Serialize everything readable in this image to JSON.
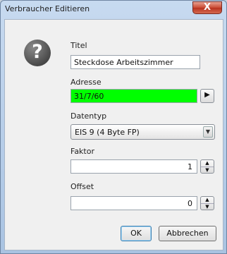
{
  "window": {
    "title": "Verbraucher Editieren",
    "close_label": "X"
  },
  "icon": {
    "name": "question-icon",
    "glyph": "?"
  },
  "fields": {
    "titel": {
      "label": "Titel",
      "value": "Steckdose Arbeitszimmer"
    },
    "adresse": {
      "label": "Adresse",
      "value": "31/7/60",
      "color": "#00ff00"
    },
    "datentyp": {
      "label": "Datentyp",
      "value": "EIS 9 (4 Byte FP)"
    },
    "faktor": {
      "label": "Faktor",
      "value": "1"
    },
    "offset": {
      "label": "Offset",
      "value": "0"
    }
  },
  "buttons": {
    "ok_label": "OK",
    "cancel_label": "Abbrechen"
  }
}
